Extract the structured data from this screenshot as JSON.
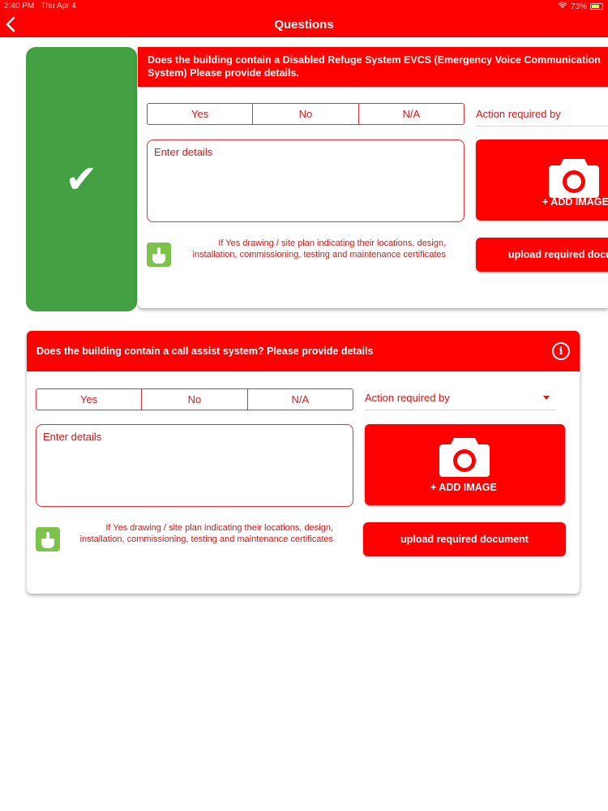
{
  "status_bar": {
    "time": "2:40 PM",
    "date": "Thu Apr 4",
    "battery": "73%"
  },
  "nav": {
    "title": "Questions"
  },
  "colors": {
    "brand": "#ff0000",
    "accent_green": "#43a143",
    "hint_green": "#7dc24b"
  },
  "questions": [
    {
      "text": "Does the building contain a Disabled Refuge System EVCS (Emergency Voice Communication System) Please provide details.",
      "options": [
        "Yes",
        "No",
        "N/A"
      ],
      "action_placeholder": "Action required by",
      "details_placeholder": "Enter details",
      "add_image_label": "+ ADD IMAGE",
      "upload_label": "upload required document",
      "hint": "If Yes drawing / site plan indicating their locations, design, installation, commissioning, testing and maintenance certificates",
      "status_icon": "check-icon"
    },
    {
      "text": "Does the building contain a call assist system? Please provide details",
      "options": [
        "Yes",
        "No",
        "N/A"
      ],
      "action_placeholder": "Action required by",
      "details_placeholder": "Enter details",
      "add_image_label": "+ ADD IMAGE",
      "upload_label": "upload required document",
      "hint": "If Yes drawing / site plan indicating their locations, design, installation, commissioning, testing and maintenance certificates",
      "info_icon": "info-icon"
    }
  ]
}
